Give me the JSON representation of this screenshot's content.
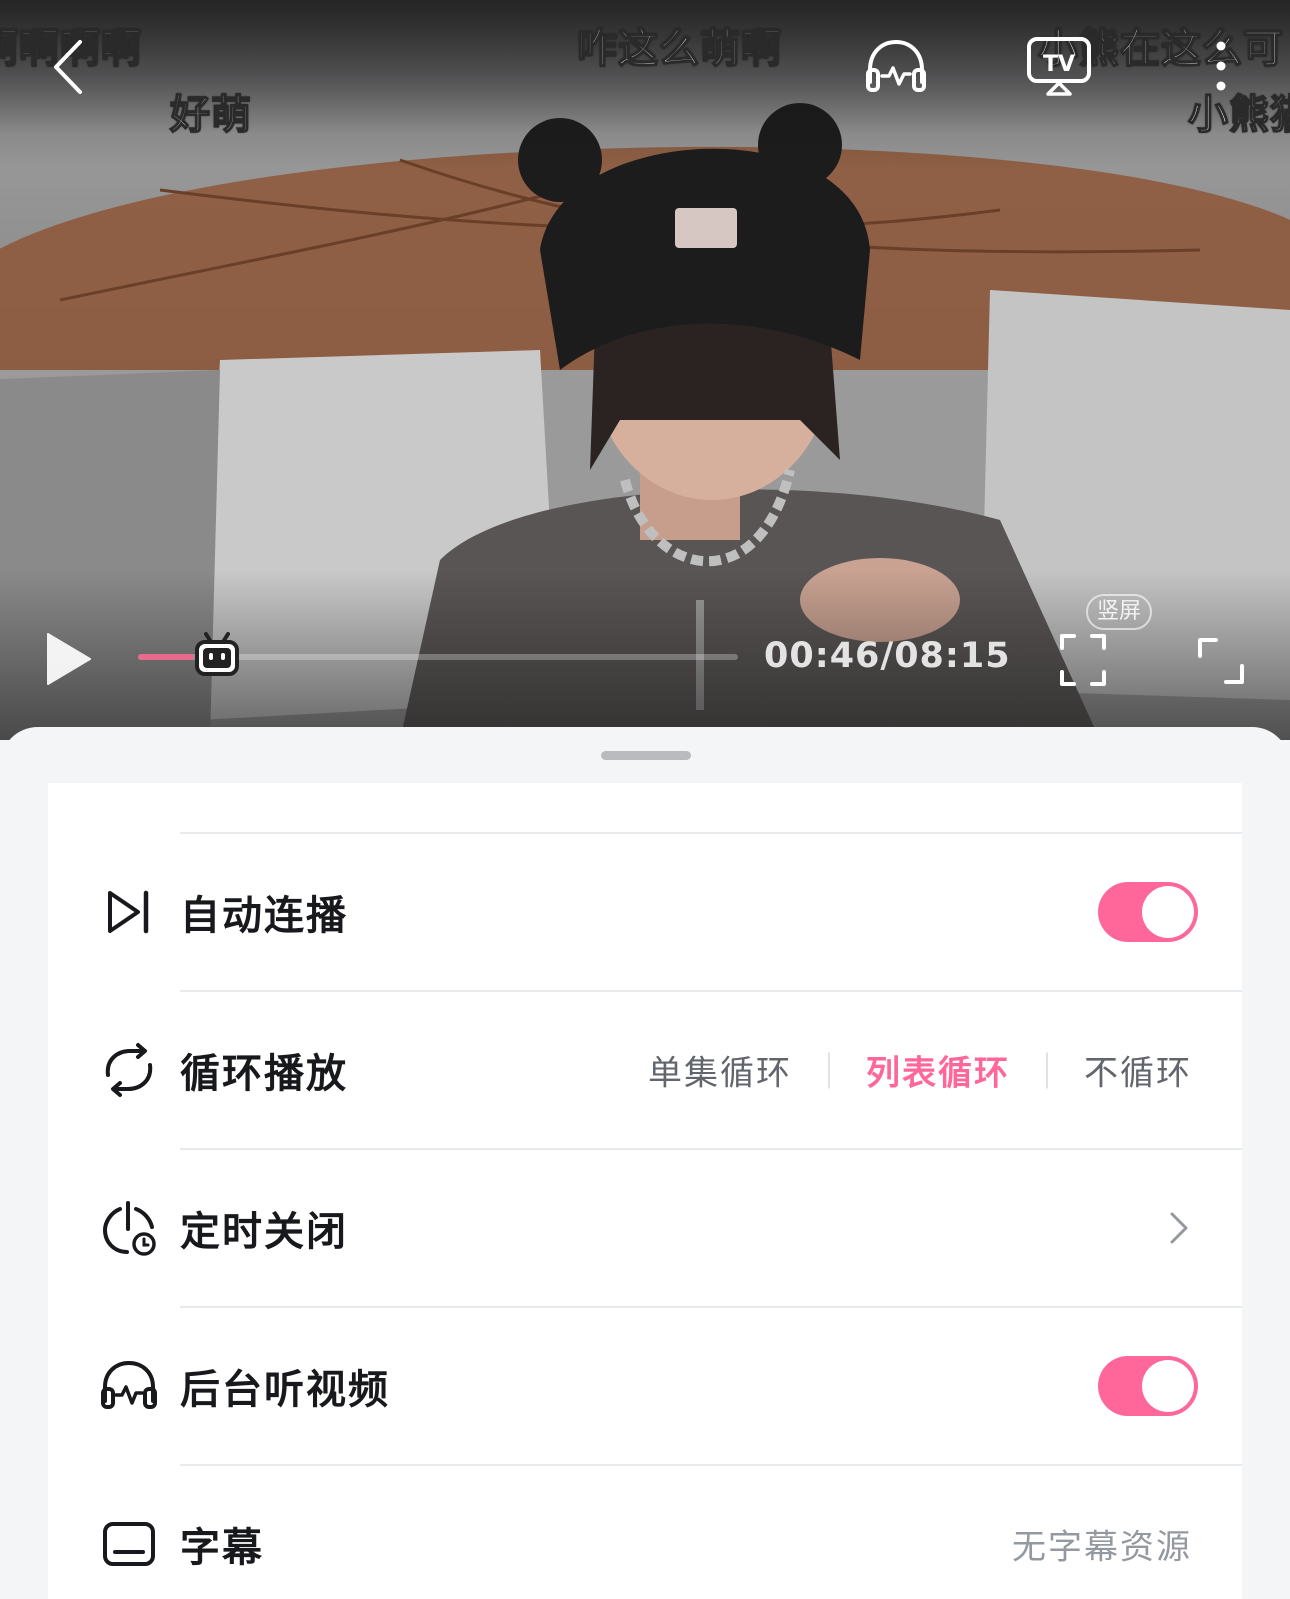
{
  "player": {
    "danmaku": [
      "啊啊啊啊",
      "好萌",
      "咋这么萌啊",
      "小熊在这么可",
      "小熊猫"
    ],
    "time_display": "00:46/08:15",
    "progress_fraction": 0.094,
    "vertical_label": "竖屏"
  },
  "settings": {
    "rows": [
      {
        "label": "自动连播",
        "icon": "skip-next-icon",
        "toggle_on": true
      },
      {
        "label": "循环播放",
        "icon": "loop-icon",
        "options": [
          "单集循环",
          "列表循环",
          "不循环"
        ],
        "selected": "列表循环"
      },
      {
        "label": "定时关闭",
        "icon": "timer-icon"
      },
      {
        "label": "后台听视频",
        "icon": "headphones-icon",
        "toggle_on": true
      },
      {
        "label": "字幕",
        "icon": "subtitle-icon",
        "value": "无字幕资源"
      }
    ]
  },
  "colors": {
    "accent": "#ff6699",
    "progress_fill": "#e86a8e",
    "label_text": "#18191c",
    "secondary_text": "#61666d",
    "muted_text": "#9499a0"
  }
}
